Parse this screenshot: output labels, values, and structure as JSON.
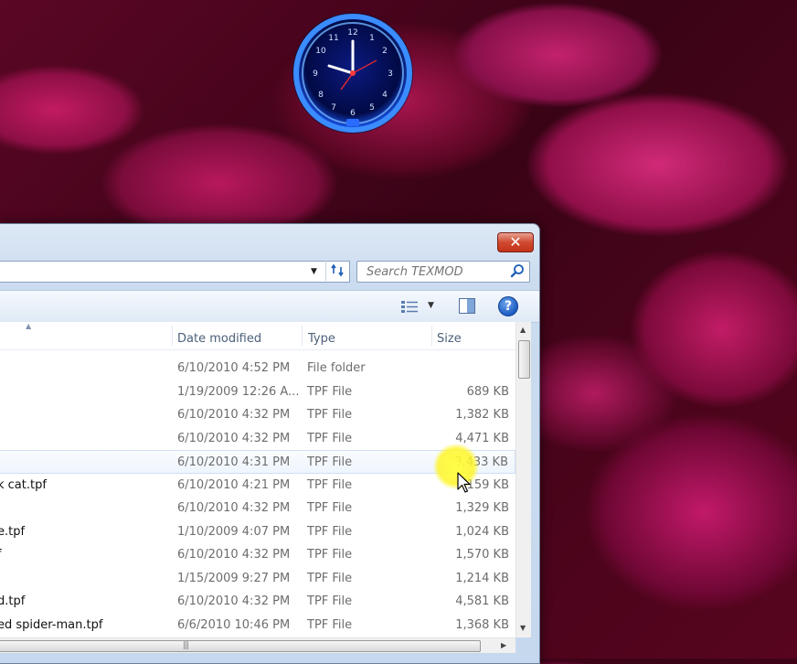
{
  "desktop": {
    "wallpaper": "pink flower petals"
  },
  "explorer": {
    "close_label": "✕",
    "search": {
      "placeholder": "Search TEXMOD"
    },
    "columns": {
      "date": "Date modified",
      "type": "Type",
      "size": "Size"
    },
    "rows": [
      {
        "name": "",
        "date": "6/10/2010 4:52 PM",
        "type": "File folder",
        "size": ""
      },
      {
        "name": "",
        "date": "1/19/2009 12:26 A...",
        "type": "TPF File",
        "size": "689 KB"
      },
      {
        "name": "",
        "date": "6/10/2010 4:32 PM",
        "type": "TPF File",
        "size": "1,382 KB"
      },
      {
        "name": "",
        "date": "6/10/2010 4:32 PM",
        "type": "TPF File",
        "size": "4,471 KB"
      },
      {
        "name": "",
        "date": "6/10/2010 4:31 PM",
        "type": "TPF File",
        "size": "3,433 KB"
      },
      {
        "name": "k cat.tpf",
        "date": "6/10/2010 4:21 PM",
        "type": "TPF File",
        "size": "159 KB"
      },
      {
        "name": "",
        "date": "6/10/2010 4:32 PM",
        "type": "TPF File",
        "size": "1,329 KB"
      },
      {
        "name": "e.tpf",
        "date": "1/10/2009 4:07 PM",
        "type": "TPF File",
        "size": "1,024 KB"
      },
      {
        "name": "f",
        "date": "6/10/2010 4:32 PM",
        "type": "TPF File",
        "size": "1,570 KB"
      },
      {
        "name": "",
        "date": "1/15/2009 9:27 PM",
        "type": "TPF File",
        "size": "1,214 KB"
      },
      {
        "name": "d.tpf",
        "date": "6/10/2010 4:32 PM",
        "type": "TPF File",
        "size": "4,581 KB"
      },
      {
        "name": "ed spider-man.tpf",
        "date": "6/6/2010 10:46 PM",
        "type": "TPF File",
        "size": "1,368 KB"
      }
    ],
    "hovered_row_index": 4
  },
  "icons": [
    "clock-gadget-icon",
    "refresh-icon",
    "search-icon",
    "views-icon",
    "preview-pane-icon",
    "help-icon",
    "mouse-cursor-icon"
  ],
  "colors": {
    "accent": "#1c5cc3",
    "close": "#c43219",
    "cursor_highlight": "#ffff3c"
  }
}
